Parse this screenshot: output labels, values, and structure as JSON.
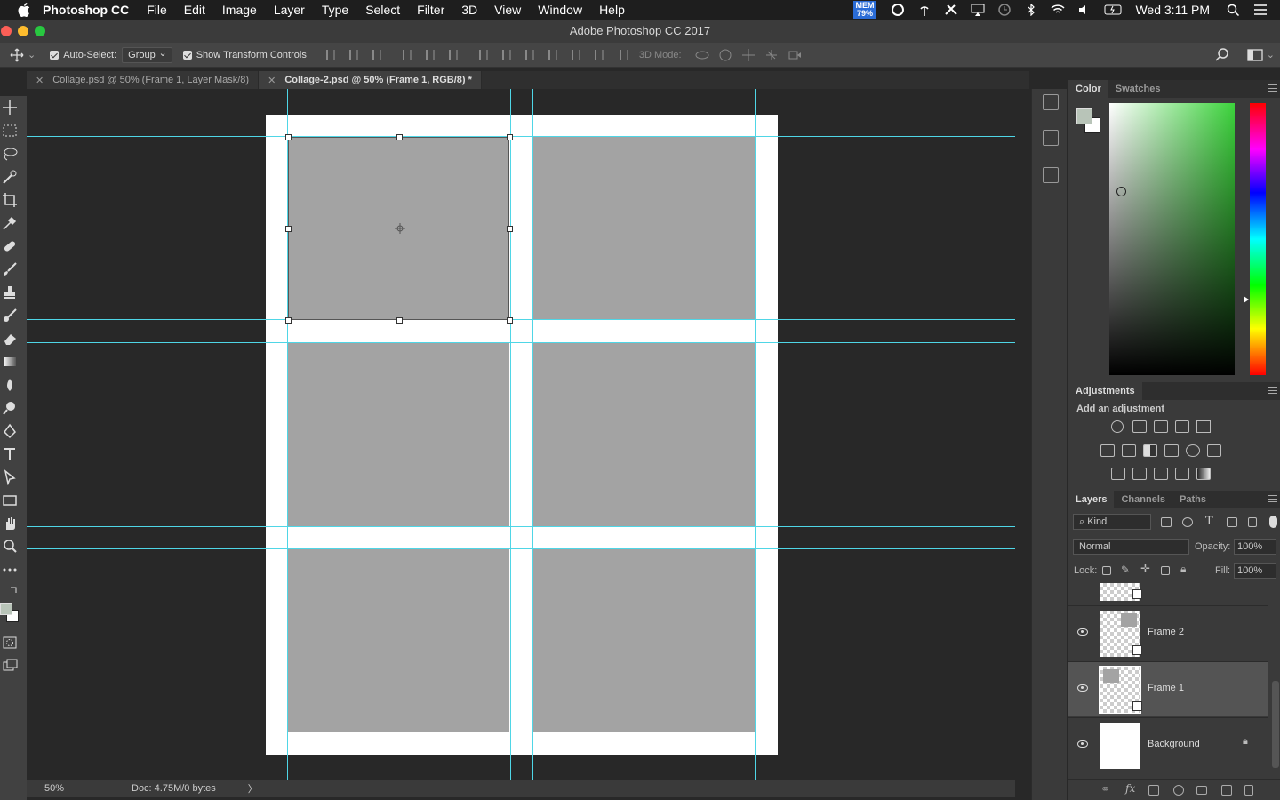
{
  "menubar": {
    "app_name": "Photoshop CC",
    "items": [
      "File",
      "Edit",
      "Image",
      "Layer",
      "Type",
      "Select",
      "Filter",
      "3D",
      "View",
      "Window",
      "Help"
    ],
    "mem_label": "MEM",
    "mem_value": "79%",
    "clock": "Wed 3:11 PM"
  },
  "window": {
    "title": "Adobe Photoshop CC 2017"
  },
  "options_bar": {
    "auto_select_label": "Auto-Select:",
    "auto_select_value": "Group",
    "show_transform_label": "Show Transform Controls",
    "mode_3d_label": "3D Mode:"
  },
  "tabs": [
    {
      "label": "Collage.psd @ 50% (Frame 1, Layer Mask/8)",
      "active": false
    },
    {
      "label": "Collage-2.psd @ 50% (Frame 1, RGB/8) *",
      "active": true
    }
  ],
  "status_bar": {
    "zoom": "50%",
    "doc_info": "Doc: 4.75M/0 bytes",
    "arrow": "〉"
  },
  "color_panel": {
    "tabs": [
      "Color",
      "Swatches"
    ],
    "foreground_color": "#b8c4b8",
    "background_color": "#ffffff"
  },
  "adjustments_panel": {
    "title": "Adjustments",
    "subtitle": "Add an adjustment"
  },
  "layers_panel": {
    "tabs": [
      "Layers",
      "Channels",
      "Paths"
    ],
    "filter_kind": "Kind",
    "blend_mode": "Normal",
    "opacity_label": "Opacity:",
    "opacity_value": "100%",
    "lock_label": "Lock:",
    "fill_label": "Fill:",
    "fill_value": "100%",
    "layers": [
      {
        "name": "Frame 2",
        "selected": false,
        "visible": true
      },
      {
        "name": "Frame 1",
        "selected": true,
        "visible": true
      },
      {
        "name": "Background",
        "selected": false,
        "visible": true,
        "locked": true
      }
    ]
  },
  "colors": {
    "guide": "#4fd6e6",
    "frame_fill": "#a3a3a3",
    "canvas_bg": "#282828"
  }
}
